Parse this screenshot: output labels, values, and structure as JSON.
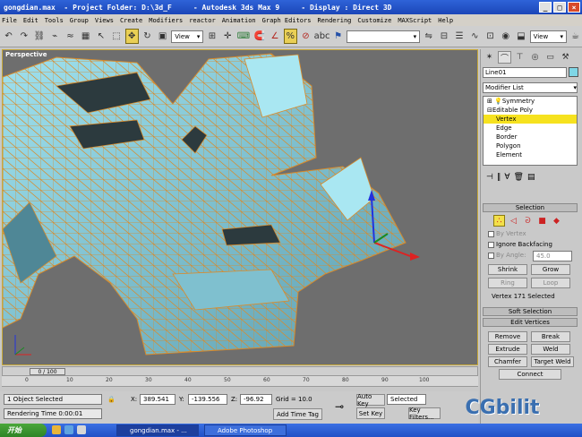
{
  "window": {
    "title": "gongdian.max  - Project Folder: D:\\3d_F     - Autodesk 3ds Max 9     - Display : Direct 3D"
  },
  "menu": [
    "File",
    "Edit",
    "Tools",
    "Group",
    "Views",
    "Create",
    "Modifiers",
    "reactor",
    "Animation",
    "Graph Editors",
    "Rendering",
    "Customize",
    "MAXScript",
    "Help"
  ],
  "toolbar": {
    "view_select_1": "View",
    "view_select_2": "View"
  },
  "viewport": {
    "label": "Perspective"
  },
  "timeline": {
    "slider": "0 / 100",
    "ticks": [
      "0",
      "10",
      "20",
      "30",
      "40",
      "50",
      "60",
      "70",
      "80",
      "90",
      "100"
    ]
  },
  "status": {
    "selection": "1 Object Selected",
    "prompt": "Rendering Time  0:00:01",
    "x_label": "X:",
    "x_value": "389.541",
    "y_label": "Y:",
    "y_value": "-139.556",
    "z_label": "Z:",
    "z_value": "-96.92",
    "grid": "Grid = 10.0",
    "add_time_tag": "Add Time Tag",
    "auto_key": "Auto Key",
    "auto_key_value": "Selected",
    "set_key": "Set Key",
    "key_filters": "Key Filters..."
  },
  "command_panel": {
    "object_name": "Line01",
    "modifier_list": "Modifier List",
    "stack": [
      "Symmetry",
      "Editable Poly",
      "Vertex",
      "Edge",
      "Border",
      "Polygon",
      "Element"
    ],
    "selection_title": "Selection",
    "by_vertex": "By Vertex",
    "ignore_backfacing": "Ignore Backfacing",
    "by_angle": "By Angle:",
    "by_angle_value": "45.0",
    "shrink": "Shrink",
    "grow": "Grow",
    "ring": "Ring",
    "loop": "Loop",
    "selected_info": "Vertex 171 Selected",
    "soft_selection_title": "Soft Selection",
    "edit_vertices_title": "Edit Vertices",
    "remove": "Remove",
    "break": "Break",
    "extrude": "Extrude",
    "weld": "Weld",
    "chamfer": "Chamfer",
    "target_weld": "Target Weld",
    "connect": "Connect"
  },
  "taskbar": {
    "start": "开始",
    "tasks": [
      "gongdian.max - ...",
      "Adobe Photoshop"
    ]
  },
  "watermark": "CGbilit"
}
